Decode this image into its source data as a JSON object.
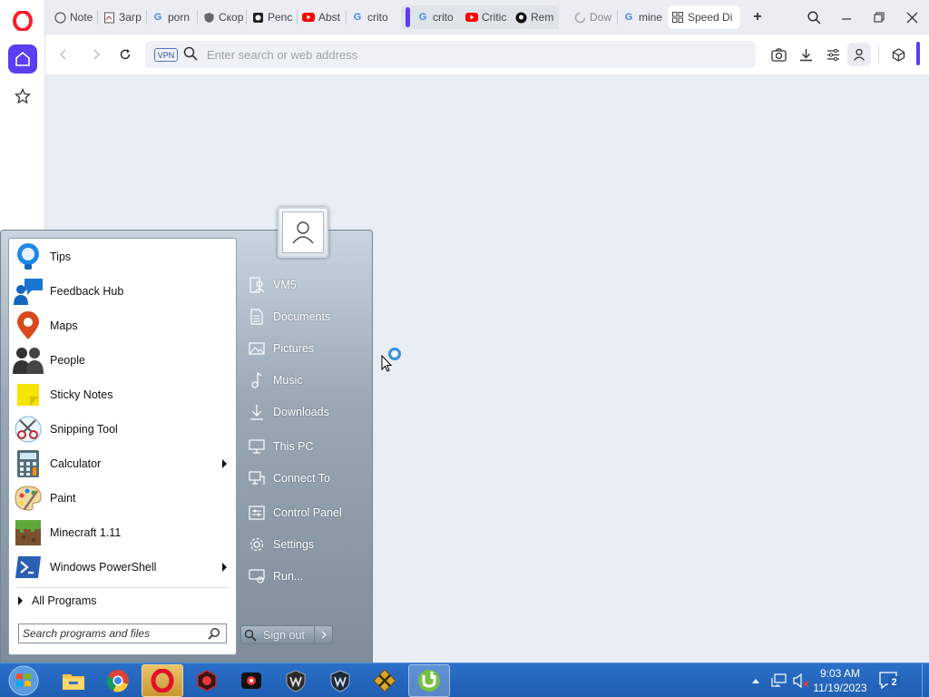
{
  "browser": {
    "tabs": [
      {
        "label": "Note",
        "icon": "globe-icon"
      },
      {
        "label": "Загр",
        "icon": "document-icon"
      },
      {
        "label": "porn",
        "icon": "google-icon"
      },
      {
        "label": "Скор",
        "icon": "shield-icon"
      },
      {
        "label": "Penc",
        "icon": "pencil-app-icon"
      },
      {
        "label": "Abst",
        "icon": "youtube-icon"
      },
      {
        "label": "crito",
        "icon": "google-icon"
      },
      {
        "label": "crito",
        "icon": "google-icon"
      },
      {
        "label": "Critic",
        "icon": "youtube-icon"
      },
      {
        "label": "Rem",
        "icon": "github-icon"
      },
      {
        "label": "Dow",
        "icon": "loading-icon"
      },
      {
        "label": "mine",
        "icon": "google-icon"
      },
      {
        "label": "Speed Di",
        "icon": "speed-dial-icon"
      }
    ],
    "address_placeholder": "Enter search or web address",
    "vpn_label": "VPN",
    "accent_color": "#5b3df5"
  },
  "start_menu": {
    "programs": [
      {
        "label": "Tips",
        "icon": "tips-bulb-icon",
        "submenu": false
      },
      {
        "label": "Feedback Hub",
        "icon": "feedback-hub-icon",
        "submenu": false
      },
      {
        "label": "Maps",
        "icon": "maps-pin-icon",
        "submenu": false
      },
      {
        "label": "People",
        "icon": "people-icon",
        "submenu": false
      },
      {
        "label": "Sticky Notes",
        "icon": "sticky-notes-icon",
        "submenu": false
      },
      {
        "label": "Snipping Tool",
        "icon": "scissors-icon",
        "submenu": false
      },
      {
        "label": "Calculator",
        "icon": "calculator-icon",
        "submenu": true
      },
      {
        "label": "Paint",
        "icon": "paint-palette-icon",
        "submenu": false
      },
      {
        "label": "Minecraft 1.11",
        "icon": "minecraft-icon",
        "submenu": false
      },
      {
        "label": "Windows PowerShell",
        "icon": "powershell-icon",
        "submenu": true
      }
    ],
    "all_programs": "All Programs",
    "search_placeholder": "Search programs and files",
    "right_items": [
      {
        "label": "VM5",
        "icon": "user-folder-icon"
      },
      {
        "label": "Documents",
        "icon": "documents-icon"
      },
      {
        "label": "Pictures",
        "icon": "pictures-icon"
      },
      {
        "label": "Music",
        "icon": "music-note-icon"
      },
      {
        "label": "Downloads",
        "icon": "download-arrow-icon"
      },
      {
        "label": "This PC",
        "icon": "computer-icon"
      },
      {
        "label": "Connect To",
        "icon": "connect-icon"
      },
      {
        "label": "Control Panel",
        "icon": "control-panel-icon"
      },
      {
        "label": "Settings",
        "icon": "gear-icon"
      },
      {
        "label": "Run...",
        "icon": "run-icon"
      }
    ],
    "sign_out": "Sign out"
  },
  "taskbar": {
    "apps": [
      "file-explorer-icon",
      "chrome-icon",
      "opera-icon",
      "app-red-hex-icon",
      "recorder-icon",
      "world-of-tanks-icon",
      "world-of-warships-icon",
      "crossed-swords-icon",
      "utorrent-icon"
    ],
    "time": "9:03 AM",
    "date": "11/19/2023",
    "notification_count": "2"
  }
}
